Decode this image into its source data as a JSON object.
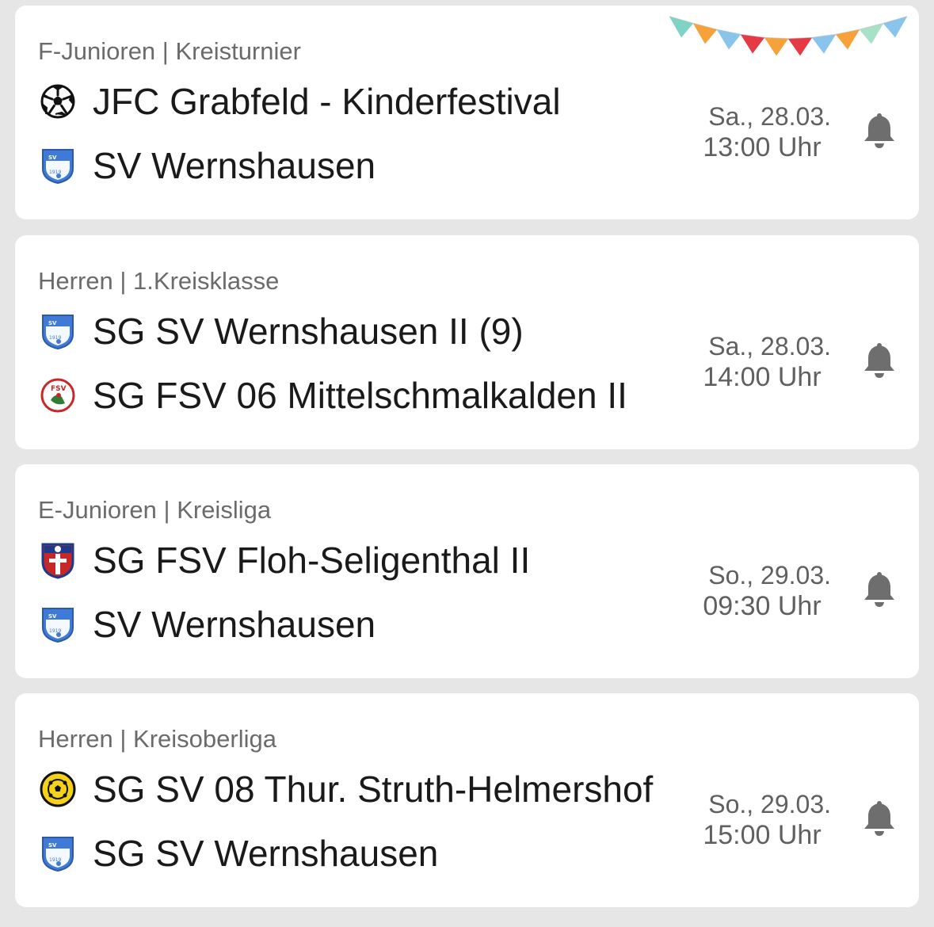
{
  "matches": [
    {
      "league": "F-Junioren | Kreisturnier",
      "home": {
        "name": "JFC Grabfeld - Kinderfestival",
        "logo": "soccer-ball-icon"
      },
      "away": {
        "name": "SV Wernshausen",
        "logo": "sv-wernshausen-crest"
      },
      "date": "Sa., 28.03.",
      "time": "13:00 Uhr",
      "festive": true
    },
    {
      "league": "Herren | 1.Kreisklasse",
      "home": {
        "name": "SG SV Wernshausen II (9)",
        "logo": "sv-wernshausen-crest"
      },
      "away": {
        "name": "SG FSV 06 Mittelschmalkalden II",
        "logo": "fsv-mittelschmalkalden-crest"
      },
      "date": "Sa., 28.03.",
      "time": "14:00 Uhr",
      "festive": false
    },
    {
      "league": "E-Junioren | Kreisliga",
      "home": {
        "name": "SG FSV Floh-Seligenthal II",
        "logo": "fsv-floh-seligenthal-crest"
      },
      "away": {
        "name": "SV Wernshausen",
        "logo": "sv-wernshausen-crest"
      },
      "date": "So., 29.03.",
      "time": "09:30 Uhr",
      "festive": false
    },
    {
      "league": "Herren | Kreisoberliga",
      "home": {
        "name": "SG SV 08 Thur. Struth-Helmershof",
        "logo": "sv-struth-helmershof-crest"
      },
      "away": {
        "name": "SG SV Wernshausen",
        "logo": "sv-wernshausen-crest"
      },
      "date": "So., 29.03.",
      "time": "15:00 Uhr",
      "festive": false
    }
  ],
  "bell_icon": "bell-icon",
  "colors": {
    "background": "#e6e6e6",
    "card": "#ffffff",
    "text_primary": "#1a1a1a",
    "text_secondary": "#6b6b6b",
    "bell": "#6e6e6e",
    "crest_blue": "#3f7bd6"
  },
  "garland_colors": [
    "#7fd3c5",
    "#f6a13a",
    "#88c4ec",
    "#e63946",
    "#f6a13a",
    "#e63946",
    "#88c4ec",
    "#f6a13a",
    "#a8e0c8",
    "#88c4ec"
  ]
}
